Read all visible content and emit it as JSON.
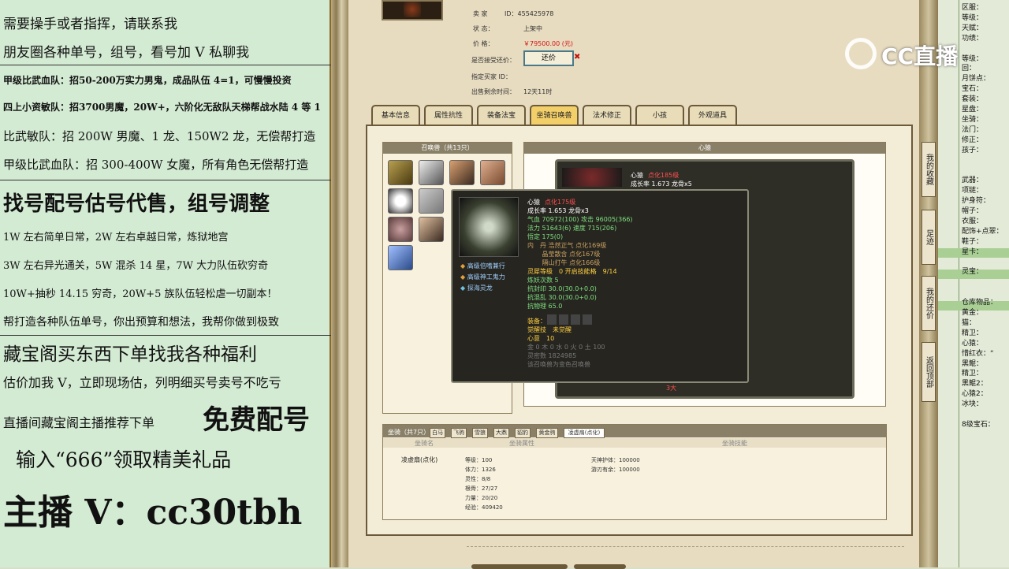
{
  "left_panel": {
    "lines": [
      "需要操手或者指挥，请联系我",
      "朋友圈各种单号，组号，看号加 V 私聊我",
      "甲级比武血队：招50-200万实力男鬼，成品队伍 4=1，可慢慢投资",
      "四上小资敏队：招3700男魔，20W+，六阶化无敌队天梯帮战水陆 4 等 1",
      "比武敏队：招 200W 男魔、1 龙、150W2 龙，无偿帮打造",
      "甲级比武血队：招 300-400W 女魔，所有角色无偿帮打造",
      "找号配号估号代售，组号调整",
      "1W 左右简单日常，2W 左右卓越日常，炼狱地宫",
      "3W 左右异光通关，5W 混杀 14 星，7W 大力队伍砍穷奇",
      "10W+抽秒 14.15 穷奇，20W+5 族队伍轻松虐一切副本！",
      "帮打造各种队伍单号，你出预算和想法，我帮你做到极致",
      "藏宝阁买东西下单找我各种福利",
      "估价加我 V，立即现场估，列明细买号卖号不吃亏",
      "直播间藏宝阁主播推荐下单",
      "免费配号",
      "输入“666”领取精美礼品",
      "主播 V：cc30tbh"
    ]
  },
  "seller_info": {
    "seller_label": "卖 家",
    "seller_id": "ID：455425978",
    "status_label": "状 态：",
    "status_value": "上架中",
    "price_label": "价 格：",
    "price_value": "￥79500.00 (元)",
    "bargain_label": "是否接受还价：",
    "bargain_button": "还价",
    "buyer_label": "指定买家 ID：",
    "time_label": "出售剩余时间：",
    "time_value": "12天11时"
  },
  "tabs": [
    "基本信息",
    "属性抗性",
    "装备法宝",
    "坐骑召唤兽",
    "法术修正",
    "小孩",
    "外观道具"
  ],
  "pet_panel": {
    "title": "召唤兽（共13只）",
    "detail_header": "心猿"
  },
  "tooltip_back": {
    "name": "心猿",
    "name_sub": "点化185级",
    "growth": "成长率 1.673 龙骨x5",
    "footer": "3大"
  },
  "tooltip": {
    "name": "心猿",
    "level": "点化175级",
    "growth": "成长率 1.653 龙骨x3",
    "hp": "气血 70972(100) 攻击 96005(366)",
    "mp": "法力 51643(6) 速度 715(206)",
    "wuxing": "悟定 175(0)",
    "neidan1": "内　丹 浩然正气 点化169级",
    "neidan2": "　　 晶莹散含 点化167级",
    "neidan3": "　　 隔山打牛 点化166级",
    "spirit": "灵犀等级　0 开启技能格　9/14",
    "lianyao": "炼妖次数 5",
    "res1": "抗封印 30.0(30.0+0.0)",
    "res2": "抗混乱 30.0(30.0+0.0)",
    "res3": "抗物理 65.0",
    "equip_label": "装备：",
    "awaken": "觉醒技　未觉醒",
    "xinyi": "心意　10",
    "elements": "金 0 木 0 水 0 火 0 土 100",
    "mijing": "灵密数 1824985",
    "note": "该召唤兽为变色召唤兽",
    "skills": [
      "高级倍嗜兼行",
      "高级神工鬼力",
      "探海灵龙"
    ]
  },
  "mount": {
    "header": "坐骑（共7只）",
    "tabs": [
      "白马",
      "飞驹",
      "雪狼",
      "大鼎",
      "貂豹",
      "黄金驹",
      "凌虚扇(点化)"
    ],
    "col_name": "坐骑名",
    "col_attr": "坐骑属性",
    "col_skill": "坐骑技能",
    "name": "凌虚扇(点化)",
    "attrs": [
      "等级：100",
      "体力：1326",
      "灵性：8/8",
      "根骨：27/27",
      "力量：20/20",
      "经验：409420"
    ],
    "skills": [
      "天神护体：100000",
      "游刃有余：100000"
    ]
  },
  "right_vbuttons": [
    "我的收藏",
    "足迹",
    "我的还价",
    "返回顶部"
  ],
  "right_strip": [
    "区服：",
    "等级：",
    "天赋：",
    "功绩：",
    "",
    "等级：",
    "回：",
    "月饼点：",
    "宝石：",
    "套装：",
    "星盘：",
    "坐骑：",
    "法门：",
    "修正：",
    "孩子：",
    "",
    "",
    "武器：",
    "项链：",
    "护身符：",
    "帽子：",
    "衣服：",
    "配饰+点翠：",
    "鞋子：",
    "星卡：",
    "",
    "灵宝：",
    "",
    "",
    "仓库物品：",
    "黄金：",
    "猫：",
    "精卫：",
    "心猿：",
    "惜红衣：“",
    "黑鲲：",
    "精卫：",
    "黑鲲2：",
    "心猿2：",
    "冰块：",
    "",
    "8级宝石："
  ],
  "watermark": "CC直播",
  "colors": {
    "price": "#d01010",
    "active_tab": "#f3cf6a",
    "green_bar": "#a9cf95"
  }
}
